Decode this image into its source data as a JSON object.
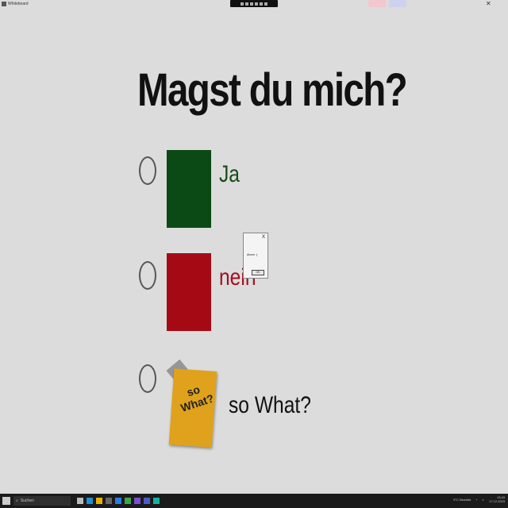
{
  "window": {
    "title": "Whiteboard"
  },
  "slide": {
    "question": "Magst du mich?",
    "options": [
      {
        "label": "Ja",
        "color": "#0b4a14",
        "label_color": "#1a4a1a"
      },
      {
        "label": "nein",
        "color": "#a50a14",
        "label_color": "#a01020"
      },
      {
        "label": "so What?",
        "note_text_line1": "so",
        "note_text_line2": "What?",
        "label_color": "#111111"
      }
    ]
  },
  "dialog": {
    "close_label": "X",
    "message": "Ahnen :(",
    "ok_label": "OK"
  },
  "taskbar": {
    "search_label": "Suchen",
    "tray_weather": "5°C Bewölkt",
    "time": "13:43",
    "date": "17.12.2023"
  },
  "colors": {
    "background": "#dcdcdc",
    "taskbar": "#1b1b1b"
  },
  "icons": [
    "start-icon",
    "search-icon",
    "taskview-icon",
    "edge-icon",
    "explorer-icon",
    "store-icon",
    "mail-icon",
    "chrome-icon",
    "vs-icon",
    "teams-icon",
    "whiteboard-icon"
  ]
}
